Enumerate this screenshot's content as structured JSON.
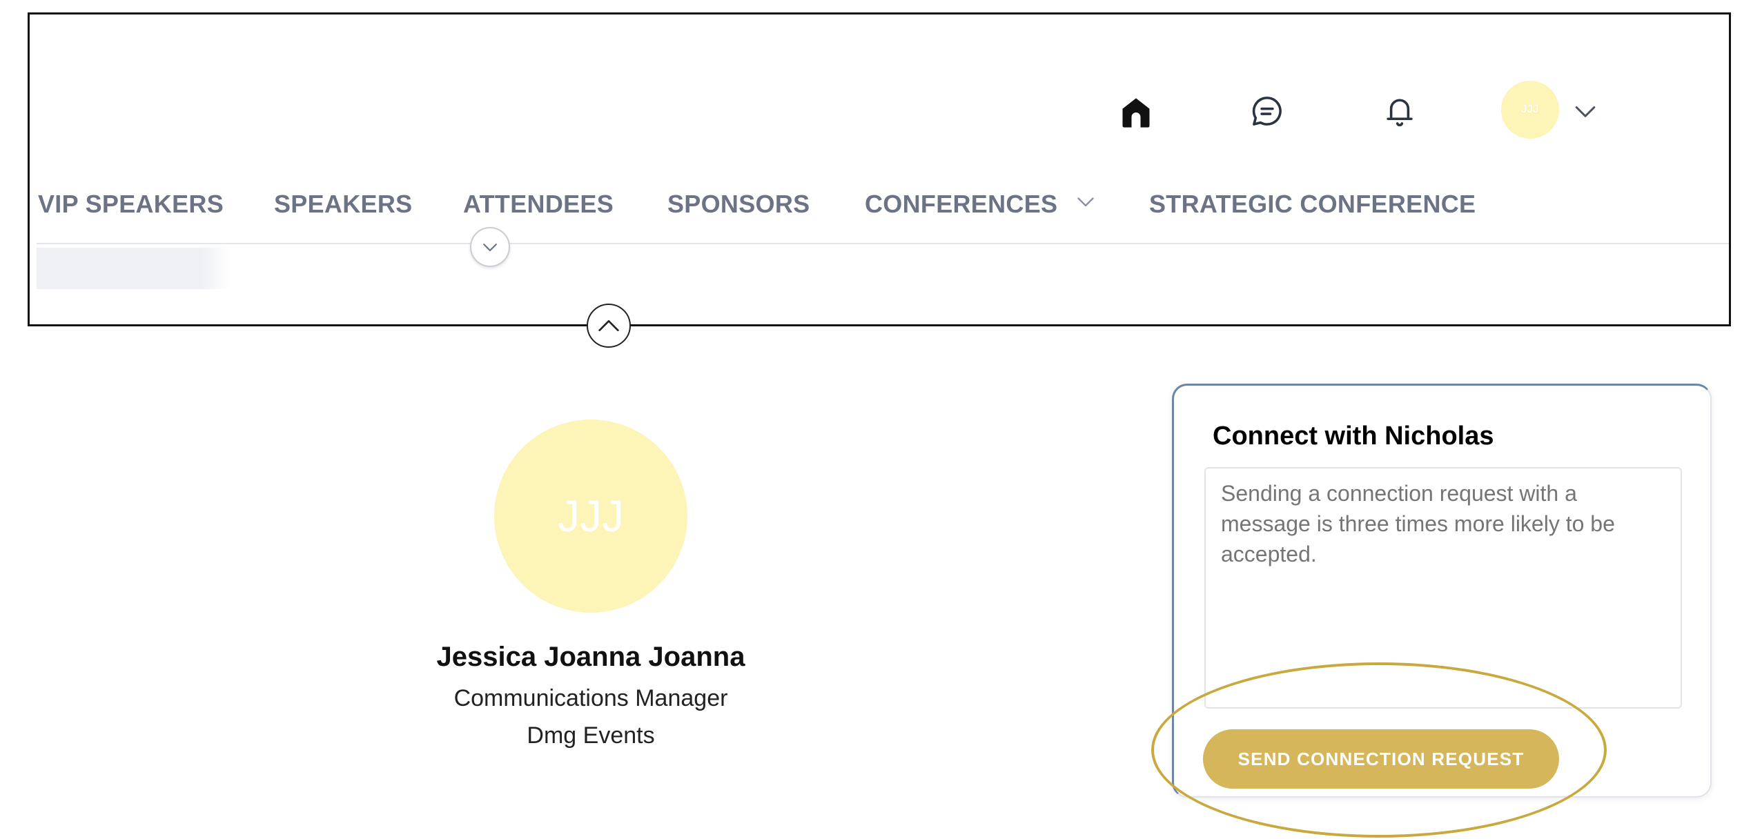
{
  "header": {
    "icons": {
      "home": "home-icon",
      "chat": "chat-icon",
      "bell": "bell-icon",
      "chevron": "chevron-down-icon"
    },
    "user_avatar_initials": "JJJ",
    "nav_items": [
      {
        "label": "VIP SPEAKERS"
      },
      {
        "label": "SPEAKERS"
      },
      {
        "label": "ATTENDEES"
      },
      {
        "label": "SPONSORS"
      },
      {
        "label": "CONFERENCES",
        "has_dropdown": true
      },
      {
        "label": "STRATEGIC CONFERENCE"
      }
    ]
  },
  "profile": {
    "initials": "JJJ",
    "name": "Jessica Joanna Joanna",
    "title": "Communications Manager",
    "company": "Dmg Events"
  },
  "connect": {
    "title": "Connect with Nicholas",
    "placeholder": "Sending a connection request with a message is three times more likely to be accepted.",
    "button_label": "SEND CONNECTION REQUEST"
  },
  "colors": {
    "avatar_bg": "#fdf4b8",
    "nav_text": "#6b7385",
    "button_bg": "#d6b65a",
    "highlight": "#c9a93e",
    "card_accent": "#6d86a5"
  }
}
